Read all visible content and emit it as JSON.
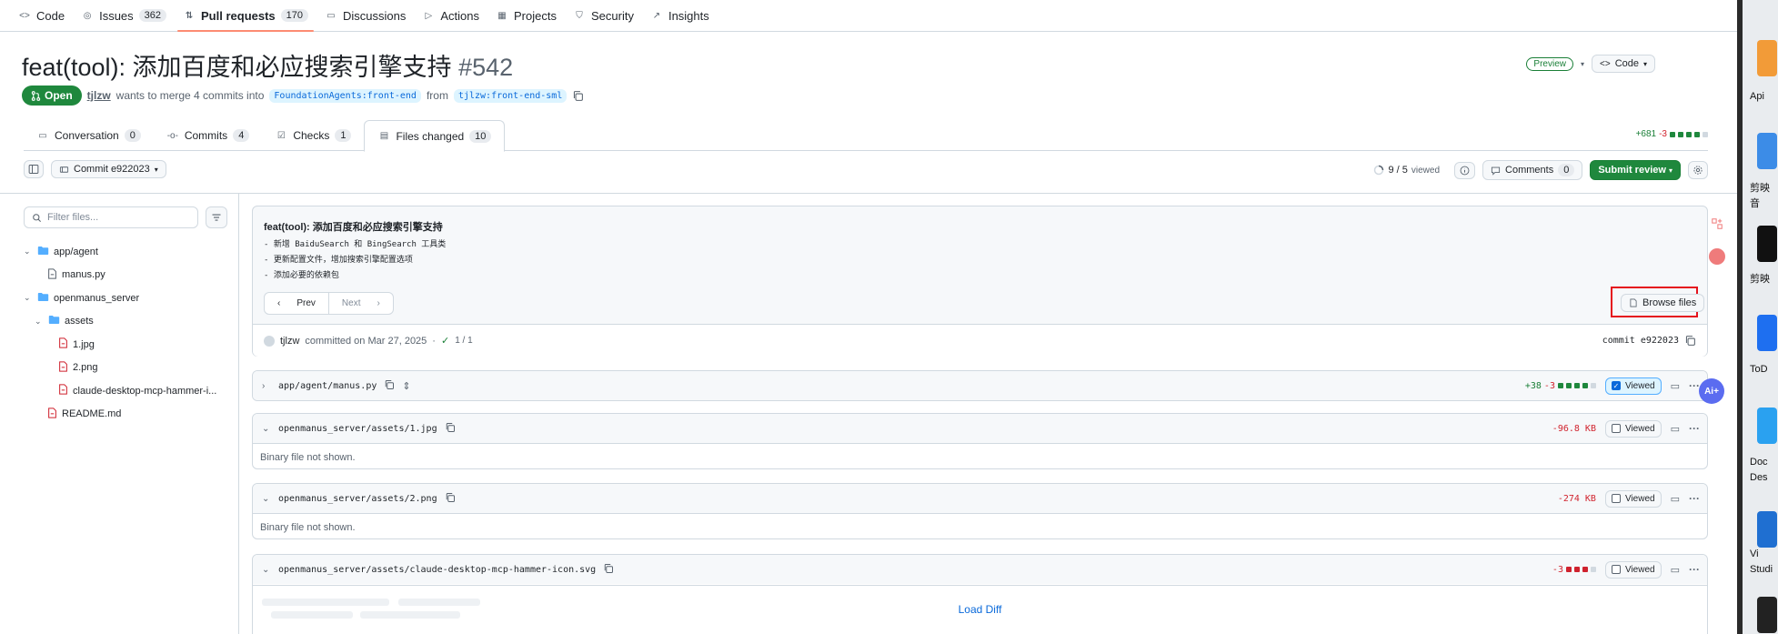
{
  "repo_nav": [
    {
      "label": "Code",
      "icon": "code-icon",
      "count": ""
    },
    {
      "label": "Issues",
      "icon": "issue-icon",
      "count": "362"
    },
    {
      "label": "Pull requests",
      "icon": "pull-request-icon",
      "count": "170",
      "active": true
    },
    {
      "label": "Discussions",
      "icon": "discussion-icon",
      "count": ""
    },
    {
      "label": "Actions",
      "icon": "play-icon",
      "count": ""
    },
    {
      "label": "Projects",
      "icon": "table-icon",
      "count": ""
    },
    {
      "label": "Security",
      "icon": "shield-icon",
      "count": ""
    },
    {
      "label": "Insights",
      "icon": "graph-icon",
      "count": ""
    }
  ],
  "pr": {
    "title": "feat(tool): 添加百度和必应搜索引擎支持",
    "number": "#542",
    "state": "Open",
    "author": "tjlzw",
    "merge_text": "wants to merge 4 commits into",
    "base_branch": "FoundationAgents:front-end",
    "from_text": "from",
    "head_branch": "tjlzw:front-end-sml",
    "preview_label": "Preview",
    "code_button": "Code"
  },
  "tabs": [
    {
      "label": "Conversation",
      "count": "0",
      "icon": "comment-icon"
    },
    {
      "label": "Commits",
      "count": "4",
      "icon": "commit-icon"
    },
    {
      "label": "Checks",
      "count": "1",
      "icon": "checklist-icon"
    },
    {
      "label": "Files changed",
      "count": "10",
      "icon": "file-diff-icon",
      "active": true
    }
  ],
  "diffstat": {
    "additions": "+681",
    "deletions": "-3"
  },
  "toolbar": {
    "commit_select": "Commit e922023",
    "viewed_count": "9 / 5",
    "viewed_label": "viewed",
    "comments_label": "Comments",
    "comments_count": "0",
    "submit_review": "Submit review"
  },
  "sidebar": {
    "filter_placeholder": "Filter files...",
    "tree": [
      {
        "type": "folder",
        "name": "app/agent",
        "depth": 0,
        "chevron": true
      },
      {
        "type": "file",
        "name": "manus.py",
        "depth": 1,
        "kind": "code"
      },
      {
        "type": "folder",
        "name": "openmanus_server",
        "depth": 0,
        "chevron": true
      },
      {
        "type": "folder",
        "name": "assets",
        "depth": 1,
        "chevron": true
      },
      {
        "type": "file",
        "name": "1.jpg",
        "depth": 2,
        "kind": "deleted"
      },
      {
        "type": "file",
        "name": "2.png",
        "depth": 2,
        "kind": "deleted"
      },
      {
        "type": "file",
        "name": "claude-desktop-mcp-hammer-i...",
        "depth": 2,
        "kind": "deleted"
      },
      {
        "type": "file",
        "name": "README.md",
        "depth": 1,
        "kind": "deleted"
      }
    ]
  },
  "commit": {
    "title": "feat(tool): 添加百度和必应搜索引擎支持",
    "lines": [
      "- 新增 BaiduSearch 和 BingSearch 工具类",
      "- 更新配置文件，增加搜索引擎配置选项",
      "- 添加必要的依赖包"
    ],
    "prev": "Prev",
    "next": "Next",
    "browse_files": "Browse files",
    "author": "tjlzw",
    "committed_text": "committed on Mar 27, 2025",
    "checks": "1 / 1",
    "sha_label": "commit e922023"
  },
  "files": [
    {
      "path": "app/agent/manus.py",
      "stat_add": "+38",
      "stat_del": "-3",
      "viewed": true,
      "collapsed": true,
      "body": ""
    },
    {
      "path": "openmanus_server/assets/1.jpg",
      "stat_add": "",
      "stat_del": "-96.8 KB",
      "viewed": false,
      "collapsed": false,
      "body": "Binary file not shown."
    },
    {
      "path": "openmanus_server/assets/2.png",
      "stat_add": "",
      "stat_del": "-274 KB",
      "viewed": false,
      "collapsed": false,
      "body": "Binary file not shown."
    },
    {
      "path": "openmanus_server/assets/claude-desktop-mcp-hammer-icon.svg",
      "stat_add": "",
      "stat_del": "-3",
      "viewed": false,
      "collapsed": false,
      "body": ""
    }
  ],
  "viewed_label": "Viewed",
  "load_diff": "Load Diff",
  "ai_button": "Ai+",
  "desktop": {
    "labels": [
      "Api",
      "剪映",
      "音",
      "剪映",
      "ToD",
      "Doc",
      "Des",
      "Vi",
      "Studi"
    ]
  }
}
